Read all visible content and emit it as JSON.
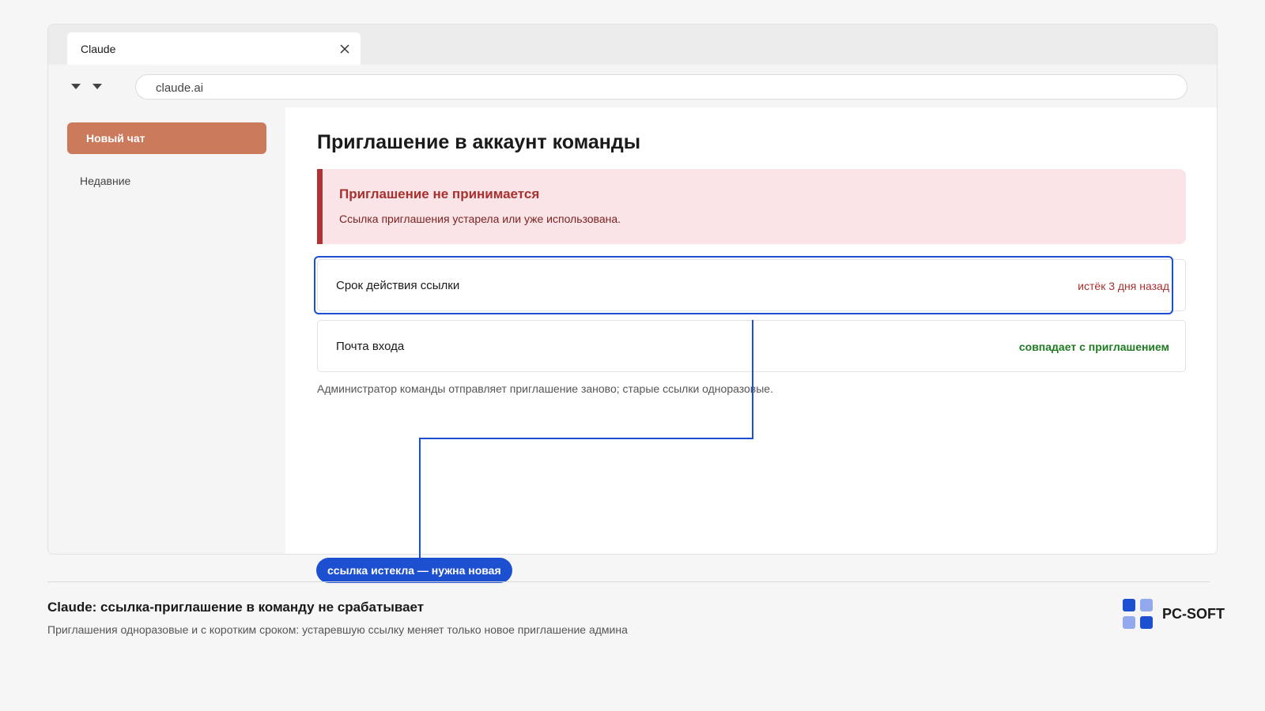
{
  "browser": {
    "tab_title": "Claude",
    "address": "claude.ai"
  },
  "sidebar": {
    "new_chat_label": "Новый чат",
    "recent_label": "Недавние"
  },
  "main": {
    "title": "Приглашение в аккаунт команды",
    "alert": {
      "title": "Приглашение не принимается",
      "text": "Ссылка приглашения устарела или уже использована."
    },
    "rows": [
      {
        "label": "Срок действия ссылки",
        "value": "истёк 3 дня назад",
        "status_color": "#a8302f"
      },
      {
        "label": "Почта входа",
        "value": "совпадает с приглашением",
        "status_color": "#1e7a21"
      }
    ],
    "footnote": "Администратор команды отправляет приглашение заново; старые ссылки одноразовые."
  },
  "annotation": {
    "callout": "ссылка истекла — нужна новая",
    "color": "#1d4fd1"
  },
  "caption": {
    "title": "Claude: ссылка-приглашение в команду не срабатывает",
    "subtitle": "Приглашения одноразовые и с коротким сроком: устаревшую ссылку меняет только новое приглашение админа"
  },
  "brand": {
    "name": "PC-SOFT"
  },
  "icons": {
    "tab_close": "close-icon",
    "nav_back": "chevron-down-icon",
    "nav_forward": "chevron-down-icon",
    "brand_logo": "grid-logo-icon"
  },
  "colors": {
    "accent": "#cc7a5c",
    "error": "#a8302f",
    "success": "#1e7a21",
    "highlight": "#1d4fd1"
  }
}
